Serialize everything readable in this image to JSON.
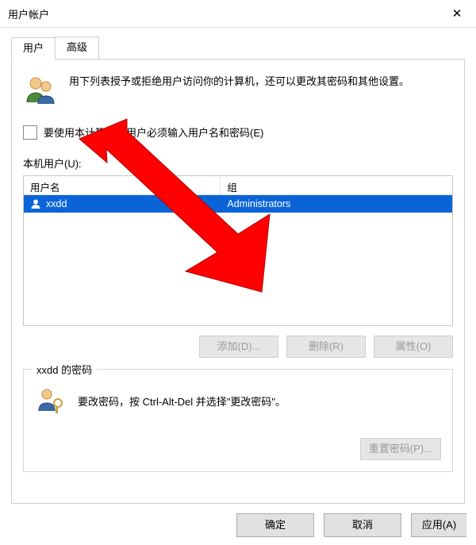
{
  "window": {
    "title": "用户帐户",
    "close_symbol": "✕"
  },
  "tabs": {
    "users": "用户",
    "advanced": "高级"
  },
  "intro": {
    "text": "用下列表授予或拒绝用户访问你的计算机，还可以更改其密码和其他设置。"
  },
  "checkbox": {
    "label": "要使用本计算机，用户必须输入用户名和密码(E)"
  },
  "list": {
    "label": "本机用户(U):",
    "col_user": "用户名",
    "col_group": "组",
    "rows": [
      {
        "user": "xxdd",
        "group": "Administrators"
      }
    ]
  },
  "buttons": {
    "add": "添加(D)...",
    "remove": "删除(R)",
    "properties": "属性(O)"
  },
  "password_group": {
    "title": "xxdd 的密码",
    "text": "要改密码，按 Ctrl-Alt-Del 并选择\"更改密码\"。",
    "reset": "重置密码(P)..."
  },
  "dialog_buttons": {
    "ok": "确定",
    "cancel": "取消",
    "apply": "应用(A)"
  }
}
